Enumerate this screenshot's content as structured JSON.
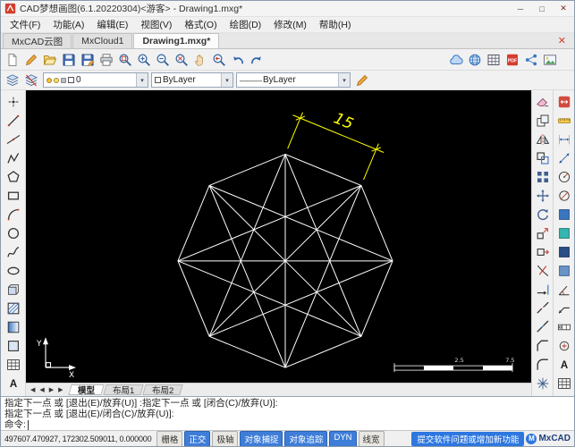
{
  "window": {
    "title": "CAD梦想画图(6.1.20220304)<游客> - Drawing1.mxg*",
    "controls": {
      "minimize": "─",
      "maximize": "□",
      "close": "✕"
    }
  },
  "glyphs": {
    "caret": "▾"
  },
  "menu": {
    "items": [
      {
        "key": "file",
        "label": "文件(F)"
      },
      {
        "key": "function",
        "label": "功能(A)"
      },
      {
        "key": "edit",
        "label": "编辑(E)"
      },
      {
        "key": "view",
        "label": "视图(V)"
      },
      {
        "key": "format",
        "label": "格式(O)"
      },
      {
        "key": "draw",
        "label": "绘图(D)"
      },
      {
        "key": "modify",
        "label": "修改(M)"
      },
      {
        "key": "help",
        "label": "帮助(H)"
      }
    ]
  },
  "doc_tabs": {
    "close_glyph": "✕",
    "tabs": [
      {
        "key": "mxcad-cloud",
        "label": "MxCAD云图",
        "active": false
      },
      {
        "key": "mxcloud1",
        "label": "MxCloud1",
        "active": false
      },
      {
        "key": "drawing1",
        "label": "Drawing1.mxg*",
        "active": true
      }
    ]
  },
  "standard_toolbar": {
    "left": [
      {
        "name": "new-file-icon",
        "label": "新建"
      },
      {
        "name": "edit-icon",
        "label": "编辑"
      },
      {
        "name": "open-file-icon",
        "label": "打开"
      },
      {
        "name": "save-icon",
        "label": "保存"
      },
      {
        "name": "save-as-icon",
        "label": "另存为"
      },
      {
        "name": "print-icon",
        "label": "打印"
      },
      {
        "name": "zoom-window-icon",
        "label": "窗口缩放"
      },
      {
        "name": "zoom-in-icon",
        "label": "放大"
      },
      {
        "name": "zoom-out-icon",
        "label": "缩小"
      },
      {
        "name": "zoom-extents-icon",
        "label": "范围缩放"
      },
      {
        "name": "pan-icon",
        "label": "平移"
      },
      {
        "name": "zoom-previous-icon",
        "label": "上一视图"
      },
      {
        "name": "undo-icon",
        "label": "撤销"
      },
      {
        "name": "redo-icon",
        "label": "重做"
      }
    ],
    "right": [
      {
        "name": "cloud-icon",
        "label": "云图"
      },
      {
        "name": "globe-icon",
        "label": "网络"
      },
      {
        "name": "grid-icon",
        "label": "表格"
      },
      {
        "name": "pdf-icon",
        "label": "输出PDF"
      },
      {
        "name": "share-icon",
        "label": "分享"
      },
      {
        "name": "image-icon",
        "label": "输出图片"
      }
    ]
  },
  "properties_toolbar": {
    "left_icons": [
      {
        "name": "layers-icon",
        "label": "图层管理"
      },
      {
        "name": "layer-off-icon",
        "label": "关闭图层"
      }
    ],
    "layer_combo": {
      "value": "0"
    },
    "color_combo": {
      "value": "ByLayer"
    },
    "linetype_combo": {
      "preview": "———",
      "value": "ByLayer"
    },
    "right_icons": [
      {
        "name": "edit-properties-icon",
        "label": "特性"
      }
    ]
  },
  "draw_toolbar": {
    "items": [
      {
        "name": "point-icon",
        "label": "点"
      },
      {
        "name": "line-icon",
        "label": "直线"
      },
      {
        "name": "xline-icon",
        "label": "构造线"
      },
      {
        "name": "polyline-icon",
        "label": "多段线"
      },
      {
        "name": "polygon-icon",
        "label": "正多边形"
      },
      {
        "name": "rectangle-icon",
        "label": "矩形"
      },
      {
        "name": "arc-icon",
        "label": "圆弧"
      },
      {
        "name": "circle-icon",
        "label": "圆"
      },
      {
        "name": "spline-icon",
        "label": "样条曲线"
      },
      {
        "name": "ellipse-icon",
        "label": "椭圆"
      },
      {
        "name": "insert-block-icon",
        "label": "插入块"
      },
      {
        "name": "hatch-icon",
        "label": "图案填充"
      },
      {
        "name": "gradient-icon",
        "label": "渐变色"
      },
      {
        "name": "region-icon",
        "label": "面域"
      },
      {
        "name": "table-icon",
        "label": "表格"
      },
      {
        "name": "mtext-icon",
        "label": "多行文字"
      }
    ]
  },
  "modify_toolbar": {
    "items": [
      {
        "name": "erase-icon",
        "label": "删除"
      },
      {
        "name": "copy-icon",
        "label": "复制"
      },
      {
        "name": "mirror-icon",
        "label": "镜像"
      },
      {
        "name": "offset-icon",
        "label": "偏移"
      },
      {
        "name": "array-icon",
        "label": "阵列"
      },
      {
        "name": "move-icon",
        "label": "移动"
      },
      {
        "name": "rotate-icon",
        "label": "旋转"
      },
      {
        "name": "scale-icon",
        "label": "缩放"
      },
      {
        "name": "stretch-icon",
        "label": "拉伸"
      },
      {
        "name": "trim-icon",
        "label": "修剪"
      },
      {
        "name": "extend-icon",
        "label": "延伸"
      },
      {
        "name": "break-icon",
        "label": "打断"
      },
      {
        "name": "join-icon",
        "label": "合并"
      },
      {
        "name": "chamfer-icon",
        "label": "倒角"
      },
      {
        "name": "fillet-icon",
        "label": "圆角"
      },
      {
        "name": "explode-icon",
        "label": "分解"
      }
    ]
  },
  "extra_toolbar": {
    "items": [
      {
        "name": "dim-style-icon",
        "label": "标注样式"
      },
      {
        "name": "measure-icon",
        "label": "测量"
      },
      {
        "name": "dim-linear-icon",
        "label": "线性标注"
      },
      {
        "name": "dim-aligned-icon",
        "label": "对齐标注"
      },
      {
        "name": "dim-radius-icon",
        "label": "半径标注"
      },
      {
        "name": "dim-diameter-icon",
        "label": "直径标注"
      },
      {
        "name": "swatch-blue-icon",
        "label": "特性匹配"
      },
      {
        "name": "swatch-teal-icon",
        "label": "图层工具"
      },
      {
        "name": "swatch-navy-icon",
        "label": "颜色设置"
      },
      {
        "name": "swatch-steel-icon",
        "label": "线型设置"
      },
      {
        "name": "dim-angular-icon",
        "label": "角度标注"
      },
      {
        "name": "leader-icon",
        "label": "引线标注"
      },
      {
        "name": "tolerance-icon",
        "label": "形位公差"
      },
      {
        "name": "center-mark-icon",
        "label": "圆心标记"
      },
      {
        "name": "text-style-icon",
        "label": "文字样式"
      },
      {
        "name": "table-style-icon",
        "label": "表格样式"
      }
    ]
  },
  "canvas": {
    "background": "#000000",
    "figure": {
      "type": "octagram",
      "center": [
        290,
        192
      ],
      "radius": 120,
      "sides": 8,
      "star_step": 3,
      "stroke": "#ffffff"
    },
    "dimension": {
      "text": "15",
      "color": "#ffff00",
      "edge": [
        0,
        7
      ],
      "offset": 44
    },
    "ucs": {
      "x_label": "X",
      "y_label": "Y"
    },
    "scale_bar": {
      "labels": [
        "2.5",
        "7.5"
      ]
    }
  },
  "layout_tabs": {
    "nav": [
      {
        "name": "layout-nav-first",
        "glyph": "◀"
      },
      {
        "name": "layout-nav-prev",
        "glyph": "◀"
      },
      {
        "name": "layout-nav-next",
        "glyph": "▶"
      },
      {
        "name": "layout-nav-last",
        "glyph": "▶"
      }
    ],
    "items": [
      {
        "key": "model",
        "label": "模型",
        "active": true
      },
      {
        "key": "layout1",
        "label": "布局1",
        "active": false
      },
      {
        "key": "layout2",
        "label": "布局2",
        "active": false
      }
    ]
  },
  "command": {
    "history": [
      "指定下一点 或 [退出(E)/放弃(U)] :指定下一点 或 [闭合(C)/放弃(U)]:",
      "指定下一点 或 [退出(E)/闭合(C)/放弃(U)]:"
    ],
    "prompt": "命令:"
  },
  "status_bar": {
    "coordinates": "497607.470927, 172302.509011, 0.000000",
    "toggles": [
      {
        "key": "grid",
        "label": "栅格",
        "active": false
      },
      {
        "key": "ortho",
        "label": "正交",
        "active": true
      },
      {
        "key": "polar",
        "label": "极轴",
        "active": false
      },
      {
        "key": "osnap",
        "label": "对象捕捉",
        "active": true
      },
      {
        "key": "otrack",
        "label": "对象追踪",
        "active": true
      },
      {
        "key": "dyn",
        "label": "DYN",
        "active": true
      },
      {
        "key": "lineweight",
        "label": "线宽",
        "active": false
      }
    ],
    "feedback_link": "提交软件问题或增加新功能",
    "logo_letter": "M",
    "logo": "MxCAD"
  },
  "colors": {
    "accent": "#2e77e0",
    "active_toggle": "#3e7dd8",
    "dimension": "#ffff00",
    "canvas_line": "#ffffff"
  }
}
